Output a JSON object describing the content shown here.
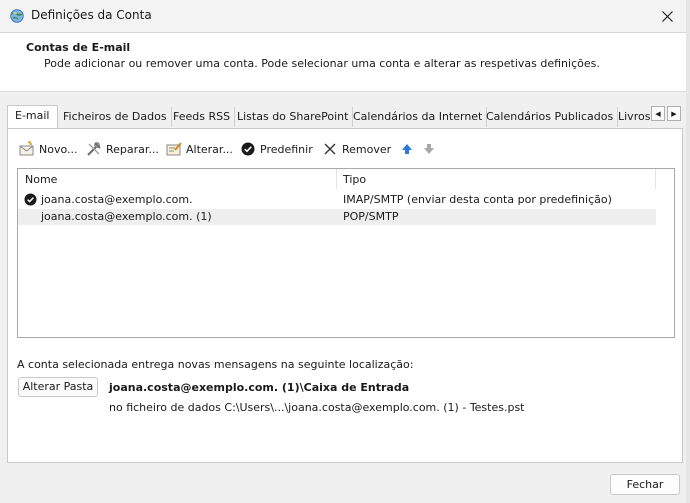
{
  "window": {
    "title": "Definições da Conta",
    "close_glyph": "✕"
  },
  "header": {
    "title": "Contas de E-mail",
    "description": "Pode adicionar ou remover uma conta. Pode selecionar uma conta e alterar as respetivas definições."
  },
  "tabs": [
    {
      "label": "E-mail",
      "active": true
    },
    {
      "label": "Ficheiros de Dados"
    },
    {
      "label": "Feeds RSS"
    },
    {
      "label": "Listas do SharePoint"
    },
    {
      "label": "Calendários da Internet"
    },
    {
      "label": "Calendários Publicados"
    },
    {
      "label": "Livros"
    }
  ],
  "toolbar": {
    "new_label": "Novo...",
    "repair_label": "Reparar...",
    "change_label": "Alterar...",
    "default_label": "Predefinir",
    "remove_label": "Remover"
  },
  "accounts": {
    "columns": {
      "name": "Nome",
      "type": "Tipo"
    },
    "rows": [
      {
        "name": "joana.costa@exemplo.com.",
        "type": "IMAP/SMTP (enviar desta conta por predefinição)",
        "default": true
      },
      {
        "name": "joana.costa@exemplo.com. (1)",
        "type": "POP/SMTP",
        "selected": true
      }
    ]
  },
  "delivery": {
    "label": "A conta selecionada entrega novas mensagens na seguinte localização:",
    "change_folder_label": "Alterar Pasta",
    "folder": "joana.costa@exemplo.com. (1)\\Caixa de Entrada",
    "data_file": "no ficheiro de dados C:\\Users\\...\\joana.costa@exemplo.com. (1) - Testes.pst"
  },
  "footer": {
    "close_label": "Fechar"
  },
  "colors": {
    "accent": "#2b7bd6",
    "check": "#1a1a1a",
    "selection": "#eeeeee"
  }
}
